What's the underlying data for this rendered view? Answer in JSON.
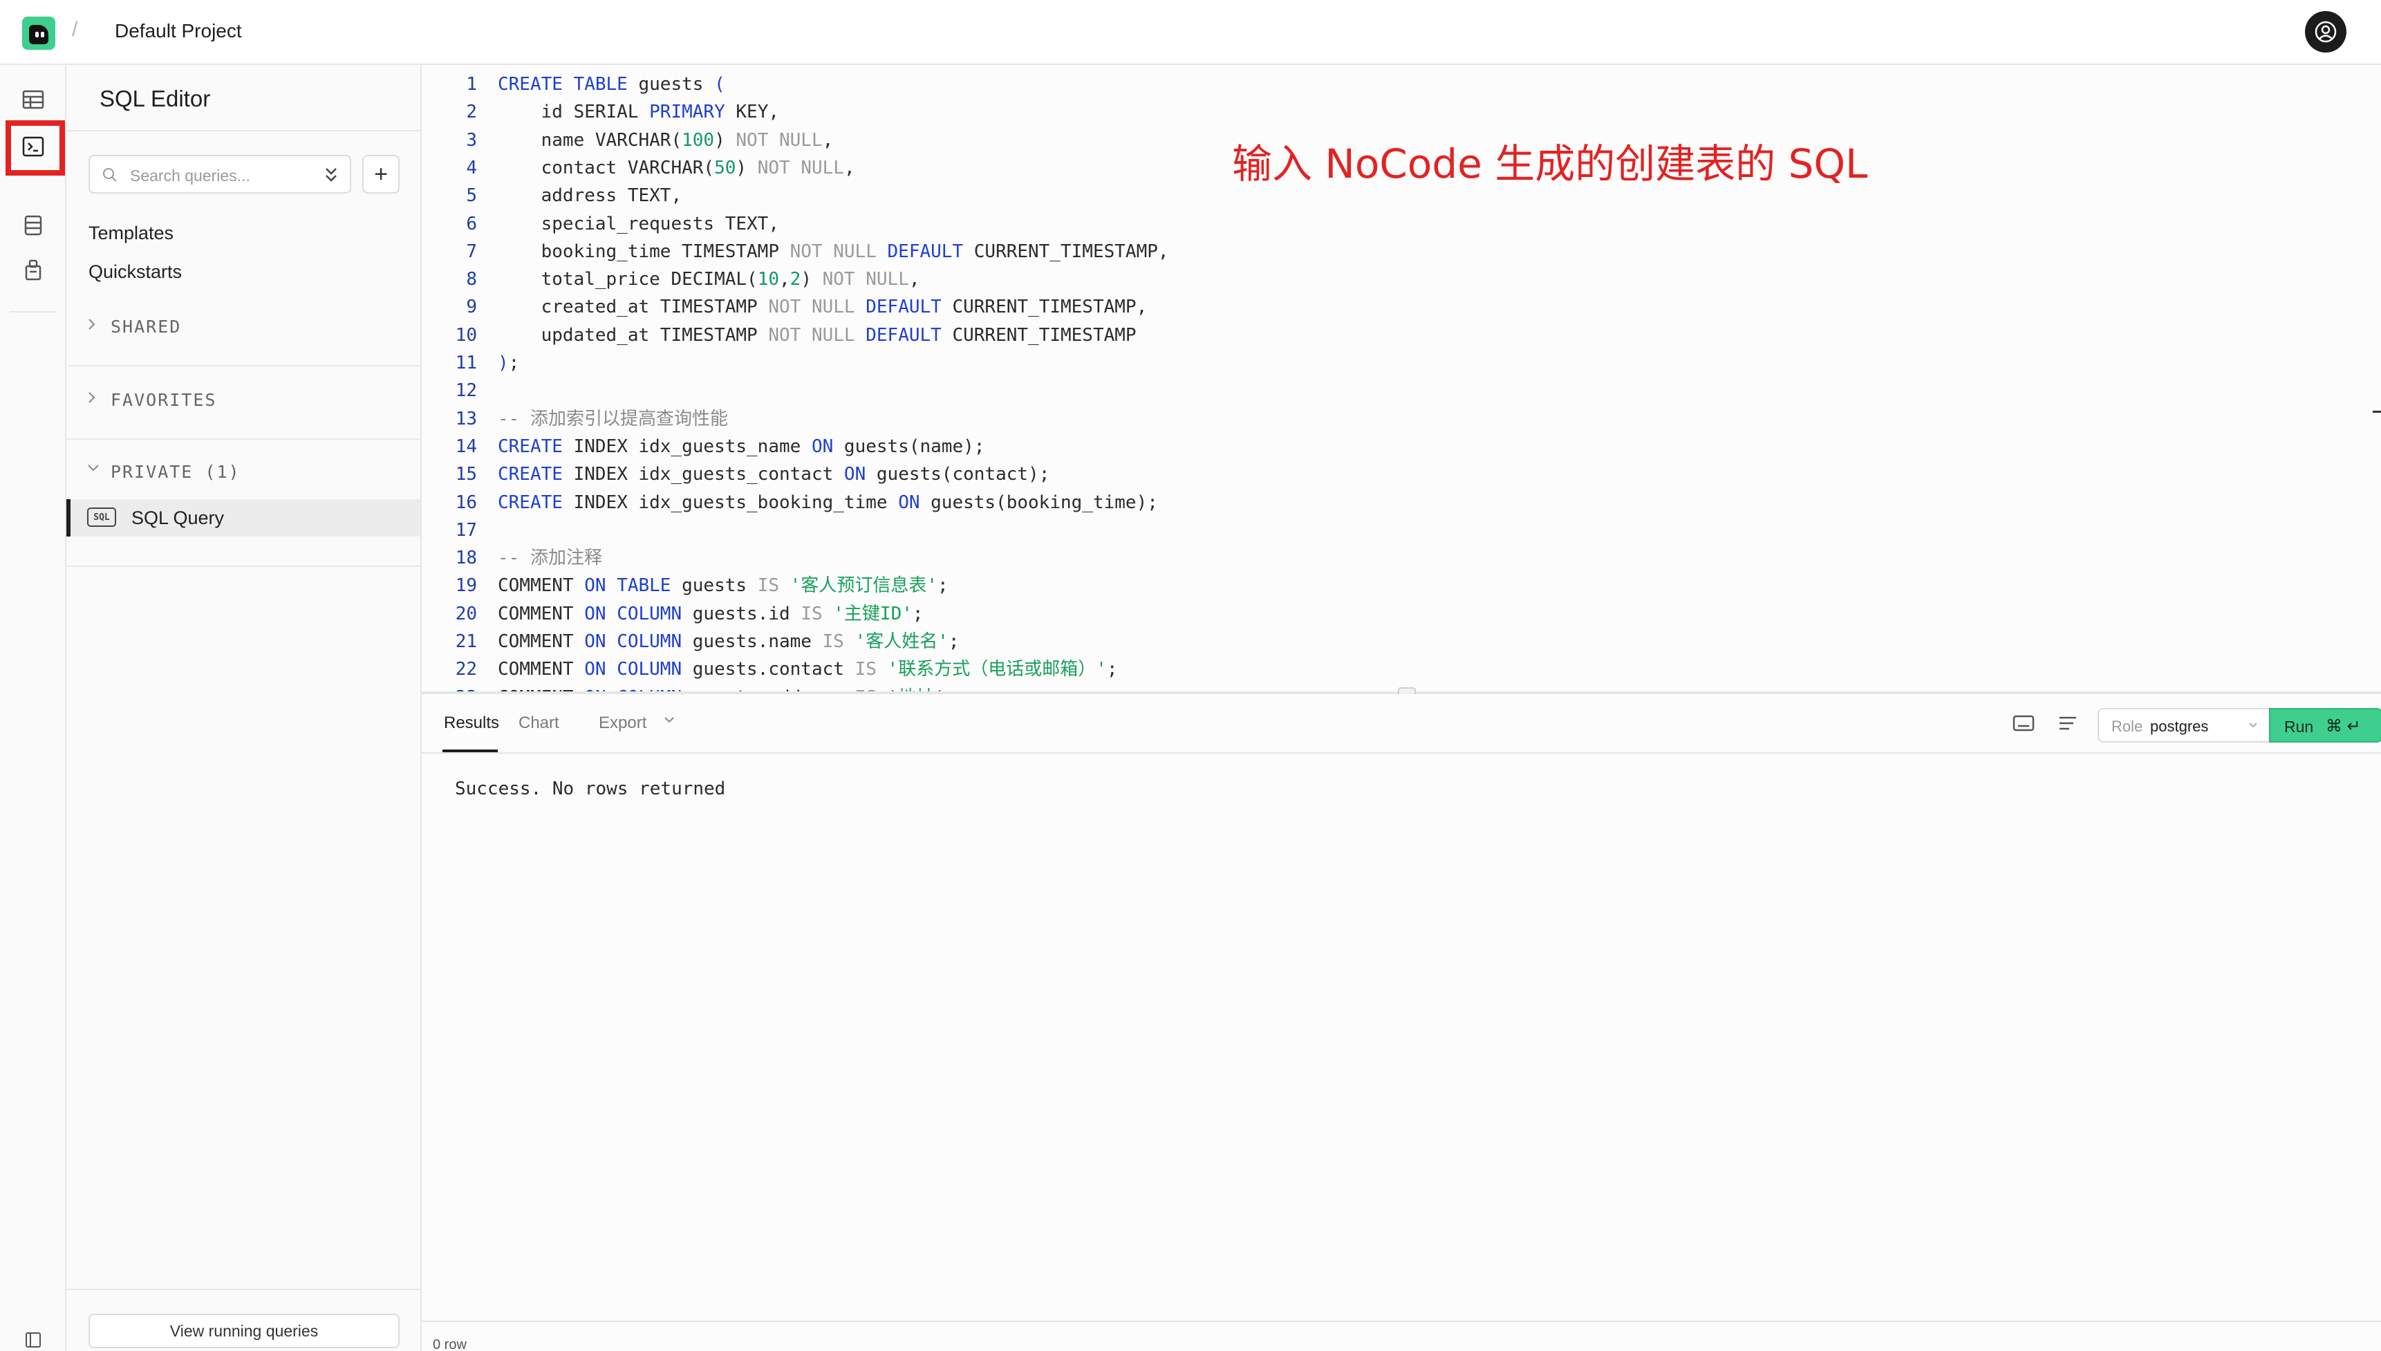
{
  "header": {
    "separator": "/",
    "project_name": "Default Project"
  },
  "rail": {
    "icons": [
      "table-editor-icon",
      "sql-editor-icon",
      "database-icon",
      "auth-icon",
      "sidebar-toggle-icon"
    ],
    "active": "sql-editor-icon"
  },
  "sidebar": {
    "title": "SQL Editor",
    "search_placeholder": "Search queries...",
    "add_label": "+",
    "links": [
      "Templates",
      "Quickstarts"
    ],
    "sections": {
      "shared": "SHARED",
      "favorites": "FAVORITES",
      "private": "PRIVATE (1)"
    },
    "query_badge": "SQL",
    "query_item": "SQL Query",
    "view_running": "View running queries"
  },
  "editor": {
    "annotation": "输入 NoCode 生成的创建表的 SQL",
    "lines": [
      {
        "n": "1",
        "html": "<span class=\"kw\">CREATE TABLE</span> guests <span class=\"kw\">(</span>"
      },
      {
        "n": "2",
        "html": "    id SERIAL <span class=\"kw\">PRIMARY</span> KEY,"
      },
      {
        "n": "3",
        "html": "    name VARCHAR(<span class=\"num\">100</span>) <span class=\"dim\">NOT NULL</span>,"
      },
      {
        "n": "4",
        "html": "    contact VARCHAR(<span class=\"num\">50</span>) <span class=\"dim\">NOT NULL</span>,"
      },
      {
        "n": "5",
        "html": "    address TEXT,"
      },
      {
        "n": "6",
        "html": "    special_requests TEXT,"
      },
      {
        "n": "7",
        "html": "    booking_time TIMESTAMP <span class=\"dim\">NOT NULL</span> <span class=\"kw\">DEFAULT</span> CURRENT_TIMESTAMP,"
      },
      {
        "n": "8",
        "html": "    total_price DECIMAL(<span class=\"num\">10</span>,<span class=\"num\">2</span>) <span class=\"dim\">NOT NULL</span>,"
      },
      {
        "n": "9",
        "html": "    created_at TIMESTAMP <span class=\"dim\">NOT NULL</span> <span class=\"kw\">DEFAULT</span> CURRENT_TIMESTAMP,"
      },
      {
        "n": "10",
        "html": "    updated_at TIMESTAMP <span class=\"dim\">NOT NULL</span> <span class=\"kw\">DEFAULT</span> CURRENT_TIMESTAMP"
      },
      {
        "n": "11",
        "html": "<span class=\"kw\">)</span>;"
      },
      {
        "n": "12",
        "html": ""
      },
      {
        "n": "13",
        "html": "<span class=\"cmt\">-- 添加索引以提高查询性能</span>"
      },
      {
        "n": "14",
        "html": "<span class=\"kw\">CREATE</span> INDEX idx_guests_name <span class=\"kw\">ON</span> guests(name);"
      },
      {
        "n": "15",
        "html": "<span class=\"kw\">CREATE</span> INDEX idx_guests_contact <span class=\"kw\">ON</span> guests(contact);"
      },
      {
        "n": "16",
        "html": "<span class=\"kw\">CREATE</span> INDEX idx_guests_booking_time <span class=\"kw\">ON</span> guests(booking_time);"
      },
      {
        "n": "17",
        "html": ""
      },
      {
        "n": "18",
        "html": "<span class=\"cmt\">-- 添加注释</span>"
      },
      {
        "n": "19",
        "html": "COMMENT <span class=\"kw\">ON TABLE</span> guests <span class=\"dim\">IS</span> <span class=\"str\">'客人预订信息表'</span>;"
      },
      {
        "n": "20",
        "html": "COMMENT <span class=\"kw\">ON COLUMN</span> guests.id <span class=\"dim\">IS</span> <span class=\"str\">'主键ID'</span>;"
      },
      {
        "n": "21",
        "html": "COMMENT <span class=\"kw\">ON COLUMN</span> guests.name <span class=\"dim\">IS</span> <span class=\"str\">'客人姓名'</span>;"
      },
      {
        "n": "22",
        "html": "COMMENT <span class=\"kw\">ON COLUMN</span> guests.contact <span class=\"dim\">IS</span> <span class=\"str\">'联系方式（电话或邮箱）'</span>;"
      },
      {
        "n": "23",
        "html": "COMMENT <span class=\"kw\">ON COLUMN</span> guests.address <span class=\"dim\">IS</span> <span class=\"str\">'地址'</span>;"
      }
    ]
  },
  "results": {
    "tabs": [
      "Results",
      "Chart",
      "Export"
    ],
    "role_label": "Role",
    "role_value": "postgres",
    "run_label": "Run",
    "run_shortcut": "⌘ ↵",
    "message": "Success. No rows returned",
    "row_count": "0 row"
  }
}
